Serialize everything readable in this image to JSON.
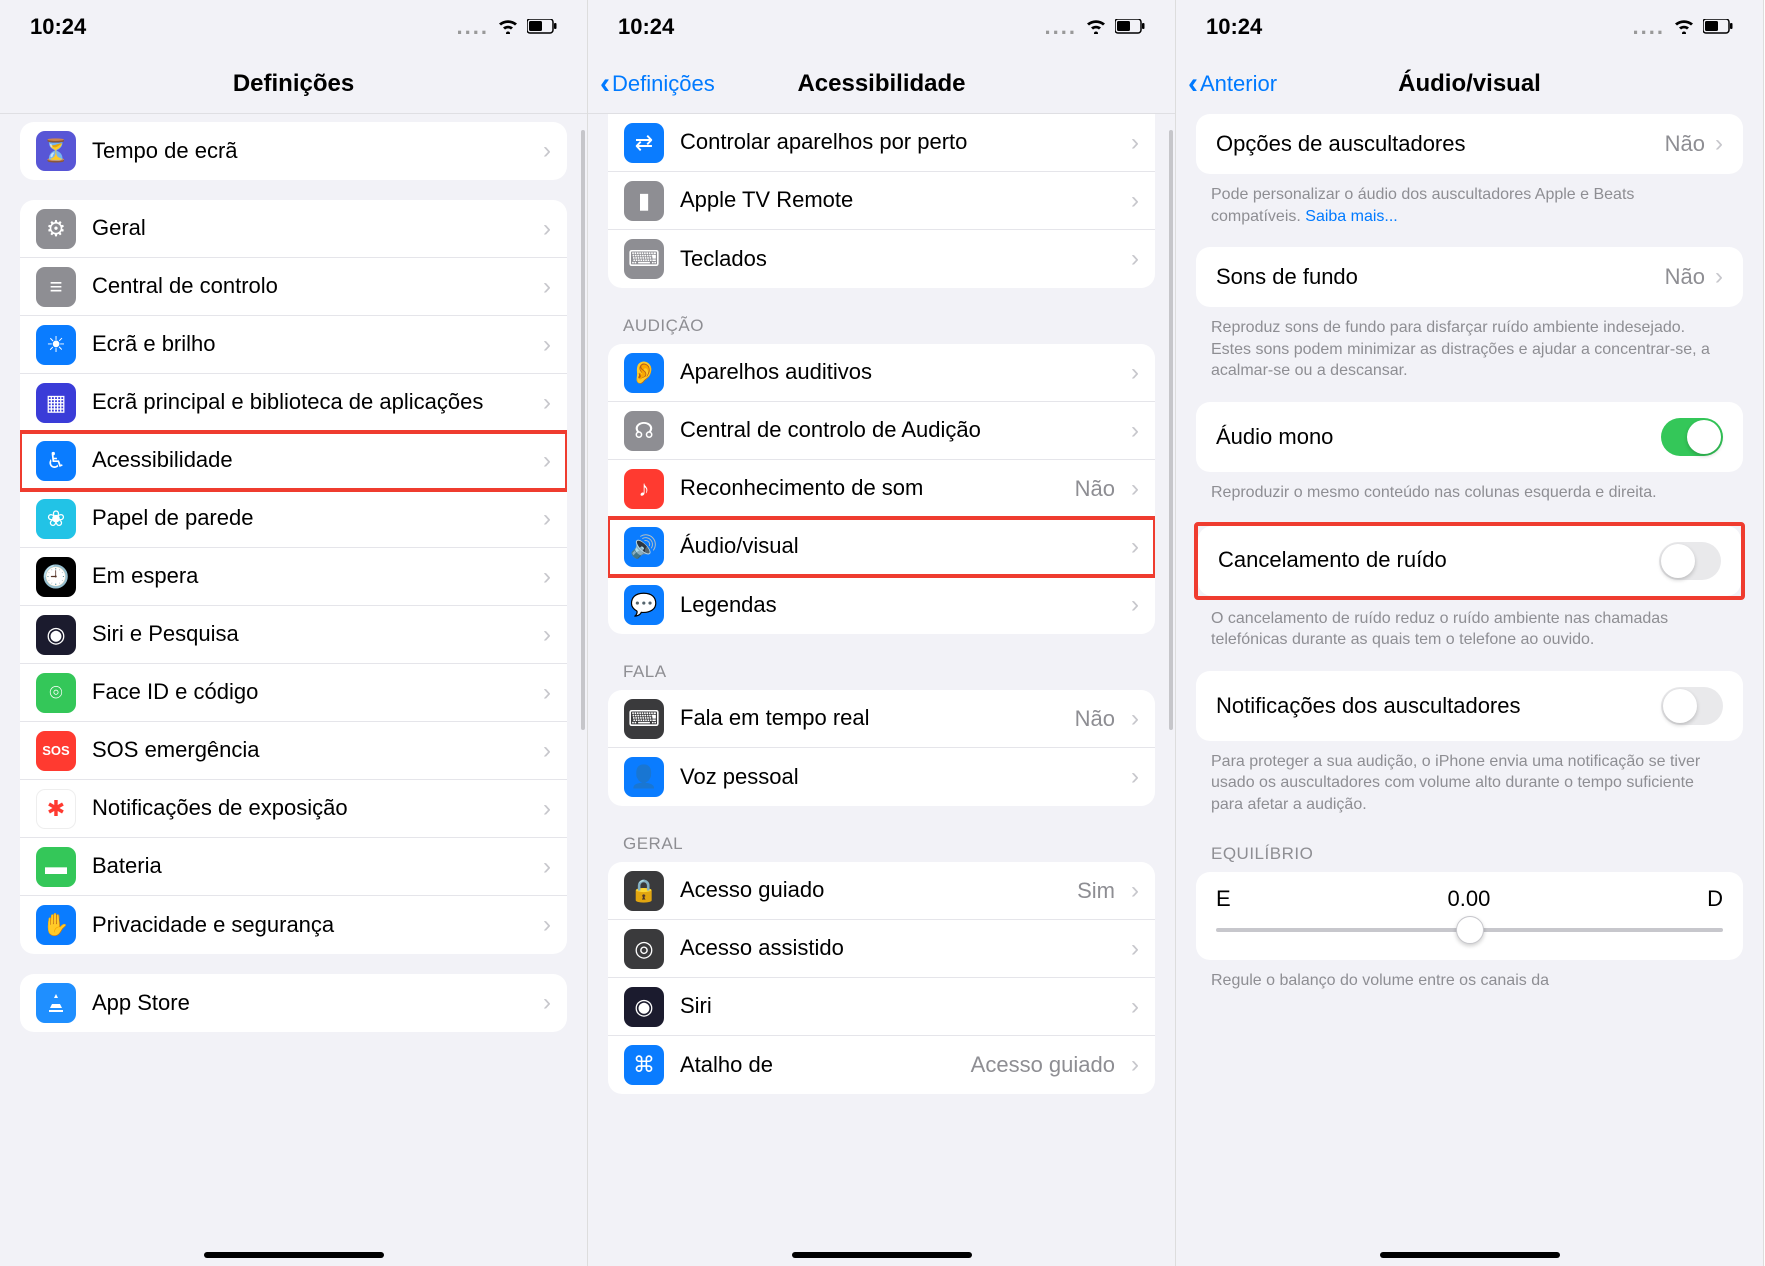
{
  "status": {
    "time": "10:24",
    "dots": "....",
    "wifi": true,
    "battery": true
  },
  "s1": {
    "title": "Definições",
    "top": {
      "label": "Tempo de ecrã",
      "icon": "hourglass-icon",
      "bg": "#5856d6"
    },
    "items": [
      {
        "label": "Geral",
        "icon": "gear-icon",
        "bg": "#8e8e93"
      },
      {
        "label": "Central de controlo",
        "icon": "switches-icon",
        "bg": "#8e8e93"
      },
      {
        "label": "Ecrã e brilho",
        "icon": "brightness-icon",
        "bg": "#0a7cff"
      },
      {
        "label": "Ecrã principal e biblioteca de aplicações",
        "icon": "grid-icon",
        "bg": "#3a3cd8"
      },
      {
        "label": "Acessibilidade",
        "icon": "accessibility-icon",
        "bg": "#0a7cff",
        "hl": true
      },
      {
        "label": "Papel de parede",
        "icon": "flower-icon",
        "bg": "#22c3e6"
      },
      {
        "label": "Em espera",
        "icon": "clock-icon",
        "bg": "#000000"
      },
      {
        "label": "Siri e Pesquisa",
        "icon": "siri-icon",
        "bg": "#1b1b2e"
      },
      {
        "label": "Face ID e código",
        "icon": "faceid-icon",
        "bg": "#34c759"
      },
      {
        "label": "SOS emergência",
        "icon": "sos-icon",
        "bg": "#ff3a30"
      },
      {
        "label": "Notificações de exposição",
        "icon": "exposure-icon",
        "bg": "#ffffff"
      },
      {
        "label": "Bateria",
        "icon": "battery-icon",
        "bg": "#34c759"
      },
      {
        "label": "Privacidade e segurança",
        "icon": "hand-icon",
        "bg": "#0a7cff"
      }
    ],
    "bottom": {
      "label": "App Store",
      "icon": "appstore-icon",
      "bg": "#1f8fff"
    }
  },
  "s2": {
    "back": "Definições",
    "title": "Acessibilidade",
    "top": [
      {
        "label": "Controlar aparelhos por perto",
        "icon": "devices-icon",
        "bg": "#0a7cff"
      },
      {
        "label": "Apple TV Remote",
        "icon": "remote-icon",
        "bg": "#8e8e93"
      },
      {
        "label": "Teclados",
        "icon": "keyboard-icon",
        "bg": "#8e8e93"
      }
    ],
    "h1": "Audição",
    "hearing": [
      {
        "label": "Aparelhos auditivos",
        "icon": "ear-icon",
        "bg": "#0a7cff"
      },
      {
        "label": "Central de controlo de Audição",
        "icon": "hearing-cc-icon",
        "bg": "#8e8e93"
      },
      {
        "label": "Reconhecimento de som",
        "icon": "sound-recog-icon",
        "bg": "#ff3a30",
        "value": "Não"
      },
      {
        "label": "Áudio/visual",
        "icon": "audiovisual-icon",
        "bg": "#0a7cff",
        "hl": true
      },
      {
        "label": "Legendas",
        "icon": "captions-icon",
        "bg": "#0a7cff"
      }
    ],
    "h2": "Fala",
    "speech": [
      {
        "label": "Fala em tempo real",
        "icon": "live-speech-icon",
        "bg": "#3a3a3c",
        "value": "Não"
      },
      {
        "label": "Voz pessoal",
        "icon": "personal-voice-icon",
        "bg": "#0a7cff"
      }
    ],
    "h3": "Geral",
    "general": [
      {
        "label": "Acesso guiado",
        "icon": "guided-icon",
        "bg": "#3a3a3c",
        "value": "Sim"
      },
      {
        "label": "Acesso assistido",
        "icon": "assist-icon",
        "bg": "#3a3a3c"
      },
      {
        "label": "Siri",
        "icon": "siri-icon",
        "bg": "#1b1b2e"
      },
      {
        "label": "Atalho de",
        "icon": "shortcut-icon",
        "bg": "#0a7cff",
        "value": "Acesso guiado"
      }
    ]
  },
  "s3": {
    "back": "Anterior",
    "title": "Áudio/visual",
    "r1": {
      "label": "Opções de auscultadores",
      "value": "Não"
    },
    "f1a": "Pode personalizar o áudio dos auscultadores Apple e Beats compatíveis. ",
    "f1b": "Saiba mais...",
    "r2": {
      "label": "Sons de fundo",
      "value": "Não"
    },
    "f2": "Reproduz sons de fundo para disfarçar ruído ambiente indesejado. Estes sons podem minimizar as distrações e ajudar a concentrar-se, a acalmar-se ou a descansar.",
    "r3": {
      "label": "Áudio mono",
      "on": true
    },
    "f3": "Reproduzir o mesmo conteúdo nas colunas esquerda e direita.",
    "r4": {
      "label": "Cancelamento de ruído",
      "on": false,
      "hl": true
    },
    "f4": "O cancelamento de ruído reduz o ruído ambiente nas chamadas telefónicas durante as quais tem o telefone ao ouvido.",
    "r5": {
      "label": "Notificações dos auscultadores",
      "on": false
    },
    "f5": "Para proteger a sua audição, o iPhone envia uma notificação se tiver usado os auscultadores com volume alto durante o tempo suficiente para afetar a audição.",
    "balHeader": "Equilíbrio",
    "bal": {
      "left": "E",
      "value": "0.00",
      "right": "D"
    },
    "f6": "Regule o balanço do volume entre os canais da"
  }
}
